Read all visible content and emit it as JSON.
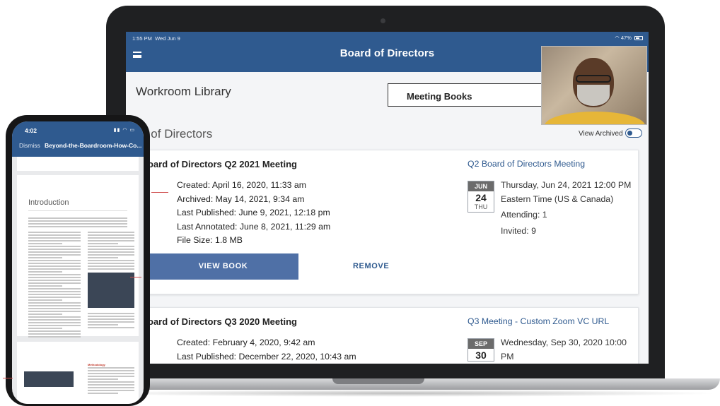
{
  "laptop": {
    "status": {
      "time": "1:55 PM",
      "date": "Wed Jun 9",
      "battery": "47%"
    },
    "app_title": "Board of Directors",
    "library_title": "Workroom Library",
    "books_label": "Meeting Books",
    "section_title": "ard of Directors",
    "view_archived": "View Archived",
    "cards": [
      {
        "title": "oard of Directors Q2 2021 Meeting",
        "created": "Created: April 16, 2020, 11:33 am",
        "archived": "Archived: May 14, 2021, 9:34 am",
        "published": "Last Published: June 9, 2021, 12:18 pm",
        "annotated": "Last Annotated: June 8, 2021, 11:29 am",
        "size": "File Size: 1.8 MB",
        "meeting_link": "Q2 Board of Directors Meeting",
        "cal_month": "JUN",
        "cal_day": "24",
        "cal_weekday": "THU",
        "datetime": "Thursday, Jun 24, 2021 12:00 PM",
        "timezone": "Eastern Time (US & Canada)",
        "attending": "Attending: 1",
        "invited": "Invited: 9",
        "view_btn": "VIEW BOOK",
        "remove_btn": "REMOVE"
      },
      {
        "title": "oard of Directors Q3 2020 Meeting",
        "created": "Created: February 4, 2020, 9:42 am",
        "published": "Last Published: December 22, 2020, 10:43 am",
        "meeting_link": "Q3 Meeting - Custom Zoom VC URL",
        "cal_month": "SEP",
        "cal_day": "30",
        "datetime": "Wednesday, Sep 30, 2020 10:00 PM"
      }
    ]
  },
  "phone": {
    "time": "4:02",
    "dismiss": "Dismiss",
    "doc_title": "Beyond-the-Boardroom-How-Co...",
    "heading": "Introduction",
    "section_label": "Methodology"
  },
  "colors": {
    "brand": "#2f5a8f",
    "button": "#4f70a6",
    "accent_red": "#d05050"
  }
}
